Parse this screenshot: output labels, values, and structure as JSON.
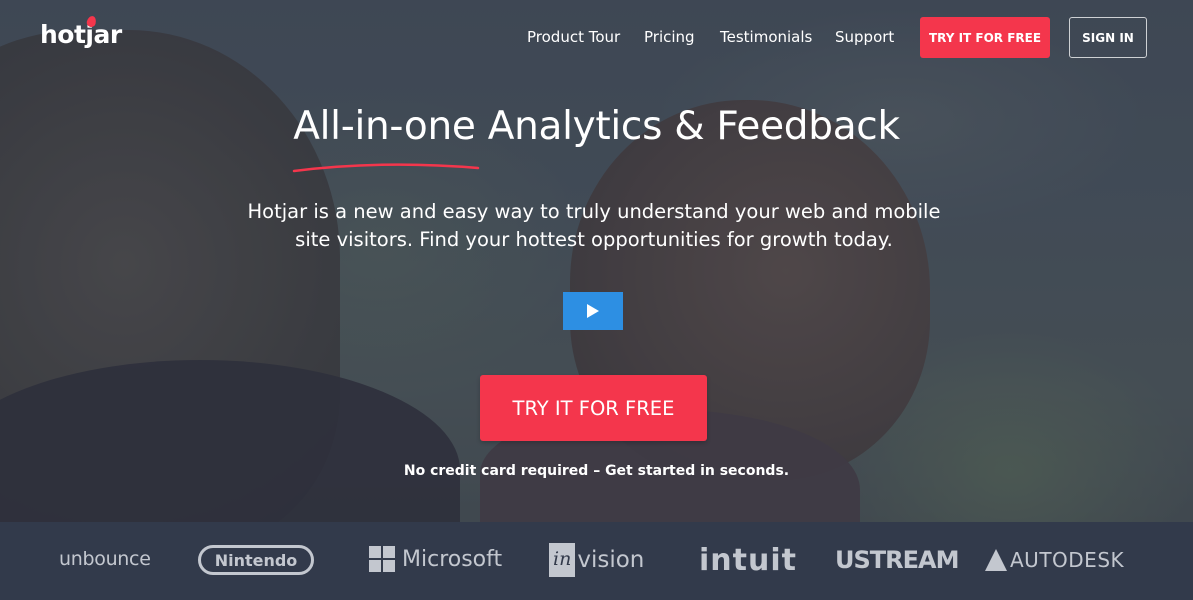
{
  "header": {
    "logo": "hotjar",
    "nav": [
      {
        "label": "Product Tour"
      },
      {
        "label": "Pricing"
      },
      {
        "label": "Testimonials"
      },
      {
        "label": "Support"
      }
    ],
    "try_button": "TRY IT FOR FREE",
    "signin_button": "SIGN IN"
  },
  "hero": {
    "headline": "All-in-one Analytics & Feedback",
    "subtext": "Hotjar is a new and easy way to truly understand your web and mobile site visitors. Find your hottest opportunities for growth today.",
    "cta": "TRY IT FOR FREE",
    "note": "No credit card required – Get started in seconds."
  },
  "logos": {
    "unbounce": "unbounce",
    "nintendo": "Nintendo",
    "microsoft": "Microsoft",
    "invision_in": "in",
    "invision_rest": "vision",
    "intuit": "intuit",
    "ustream": "USTREAM",
    "autodesk": "AUTODESK"
  },
  "colors": {
    "accent": "#f4364c",
    "play": "#2d8fe3",
    "logobar": "#323a4b"
  }
}
